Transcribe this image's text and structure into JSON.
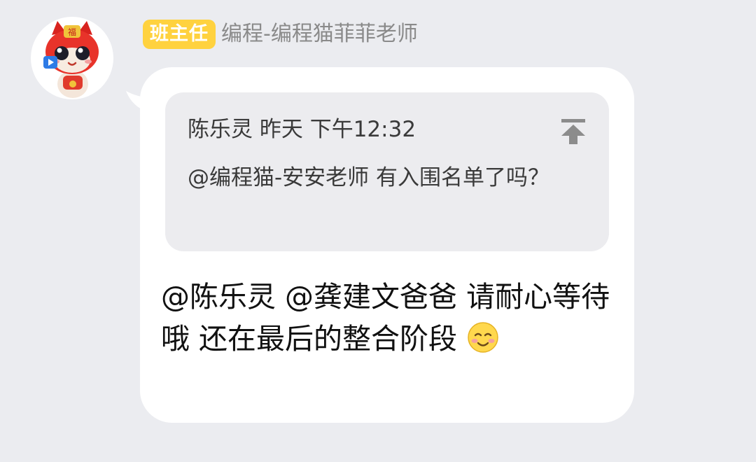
{
  "message": {
    "role_badge": "班主任",
    "sender_name": "编程-编程猫菲菲老师",
    "quote": {
      "meta": "陈乐灵 昨天 下午12:32",
      "text": "@编程猫-安安老师 有入围名单了吗？",
      "jump_icon": "jump-to-top-icon"
    },
    "body_text": "@陈乐灵 @龚建文爸爸  请耐心等待哦 还在最后的整合阶段",
    "emoji": "smiling-face-emoji"
  },
  "colors": {
    "background": "#ebecf0",
    "badge": "#ffd23f",
    "bubble": "#ffffff",
    "quote_card": "#ececef",
    "sender_name": "#8a8a8a"
  }
}
